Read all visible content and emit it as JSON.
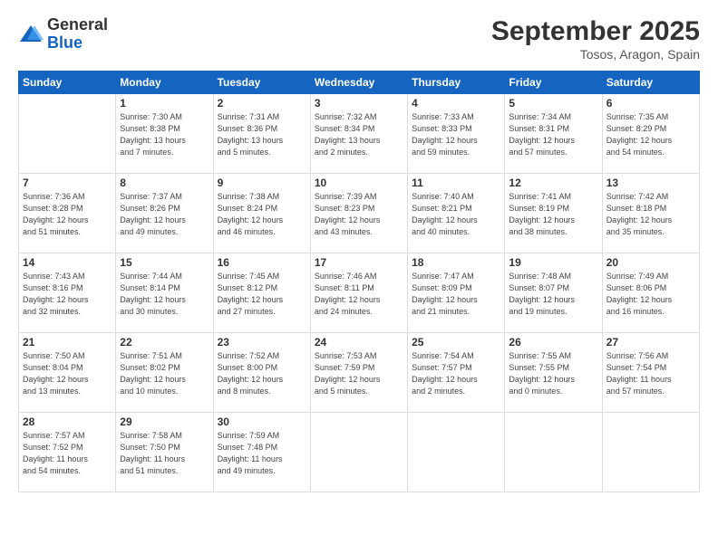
{
  "logo": {
    "general": "General",
    "blue": "Blue"
  },
  "title": "September 2025",
  "location": "Tosos, Aragon, Spain",
  "days_of_week": [
    "Sunday",
    "Monday",
    "Tuesday",
    "Wednesday",
    "Thursday",
    "Friday",
    "Saturday"
  ],
  "weeks": [
    [
      {
        "day": "",
        "info": ""
      },
      {
        "day": "1",
        "info": "Sunrise: 7:30 AM\nSunset: 8:38 PM\nDaylight: 13 hours\nand 7 minutes."
      },
      {
        "day": "2",
        "info": "Sunrise: 7:31 AM\nSunset: 8:36 PM\nDaylight: 13 hours\nand 5 minutes."
      },
      {
        "day": "3",
        "info": "Sunrise: 7:32 AM\nSunset: 8:34 PM\nDaylight: 13 hours\nand 2 minutes."
      },
      {
        "day": "4",
        "info": "Sunrise: 7:33 AM\nSunset: 8:33 PM\nDaylight: 12 hours\nand 59 minutes."
      },
      {
        "day": "5",
        "info": "Sunrise: 7:34 AM\nSunset: 8:31 PM\nDaylight: 12 hours\nand 57 minutes."
      },
      {
        "day": "6",
        "info": "Sunrise: 7:35 AM\nSunset: 8:29 PM\nDaylight: 12 hours\nand 54 minutes."
      }
    ],
    [
      {
        "day": "7",
        "info": "Sunrise: 7:36 AM\nSunset: 8:28 PM\nDaylight: 12 hours\nand 51 minutes."
      },
      {
        "day": "8",
        "info": "Sunrise: 7:37 AM\nSunset: 8:26 PM\nDaylight: 12 hours\nand 49 minutes."
      },
      {
        "day": "9",
        "info": "Sunrise: 7:38 AM\nSunset: 8:24 PM\nDaylight: 12 hours\nand 46 minutes."
      },
      {
        "day": "10",
        "info": "Sunrise: 7:39 AM\nSunset: 8:23 PM\nDaylight: 12 hours\nand 43 minutes."
      },
      {
        "day": "11",
        "info": "Sunrise: 7:40 AM\nSunset: 8:21 PM\nDaylight: 12 hours\nand 40 minutes."
      },
      {
        "day": "12",
        "info": "Sunrise: 7:41 AM\nSunset: 8:19 PM\nDaylight: 12 hours\nand 38 minutes."
      },
      {
        "day": "13",
        "info": "Sunrise: 7:42 AM\nSunset: 8:18 PM\nDaylight: 12 hours\nand 35 minutes."
      }
    ],
    [
      {
        "day": "14",
        "info": "Sunrise: 7:43 AM\nSunset: 8:16 PM\nDaylight: 12 hours\nand 32 minutes."
      },
      {
        "day": "15",
        "info": "Sunrise: 7:44 AM\nSunset: 8:14 PM\nDaylight: 12 hours\nand 30 minutes."
      },
      {
        "day": "16",
        "info": "Sunrise: 7:45 AM\nSunset: 8:12 PM\nDaylight: 12 hours\nand 27 minutes."
      },
      {
        "day": "17",
        "info": "Sunrise: 7:46 AM\nSunset: 8:11 PM\nDaylight: 12 hours\nand 24 minutes."
      },
      {
        "day": "18",
        "info": "Sunrise: 7:47 AM\nSunset: 8:09 PM\nDaylight: 12 hours\nand 21 minutes."
      },
      {
        "day": "19",
        "info": "Sunrise: 7:48 AM\nSunset: 8:07 PM\nDaylight: 12 hours\nand 19 minutes."
      },
      {
        "day": "20",
        "info": "Sunrise: 7:49 AM\nSunset: 8:06 PM\nDaylight: 12 hours\nand 16 minutes."
      }
    ],
    [
      {
        "day": "21",
        "info": "Sunrise: 7:50 AM\nSunset: 8:04 PM\nDaylight: 12 hours\nand 13 minutes."
      },
      {
        "day": "22",
        "info": "Sunrise: 7:51 AM\nSunset: 8:02 PM\nDaylight: 12 hours\nand 10 minutes."
      },
      {
        "day": "23",
        "info": "Sunrise: 7:52 AM\nSunset: 8:00 PM\nDaylight: 12 hours\nand 8 minutes."
      },
      {
        "day": "24",
        "info": "Sunrise: 7:53 AM\nSunset: 7:59 PM\nDaylight: 12 hours\nand 5 minutes."
      },
      {
        "day": "25",
        "info": "Sunrise: 7:54 AM\nSunset: 7:57 PM\nDaylight: 12 hours\nand 2 minutes."
      },
      {
        "day": "26",
        "info": "Sunrise: 7:55 AM\nSunset: 7:55 PM\nDaylight: 12 hours\nand 0 minutes."
      },
      {
        "day": "27",
        "info": "Sunrise: 7:56 AM\nSunset: 7:54 PM\nDaylight: 11 hours\nand 57 minutes."
      }
    ],
    [
      {
        "day": "28",
        "info": "Sunrise: 7:57 AM\nSunset: 7:52 PM\nDaylight: 11 hours\nand 54 minutes."
      },
      {
        "day": "29",
        "info": "Sunrise: 7:58 AM\nSunset: 7:50 PM\nDaylight: 11 hours\nand 51 minutes."
      },
      {
        "day": "30",
        "info": "Sunrise: 7:59 AM\nSunset: 7:48 PM\nDaylight: 11 hours\nand 49 minutes."
      },
      {
        "day": "",
        "info": ""
      },
      {
        "day": "",
        "info": ""
      },
      {
        "day": "",
        "info": ""
      },
      {
        "day": "",
        "info": ""
      }
    ]
  ]
}
